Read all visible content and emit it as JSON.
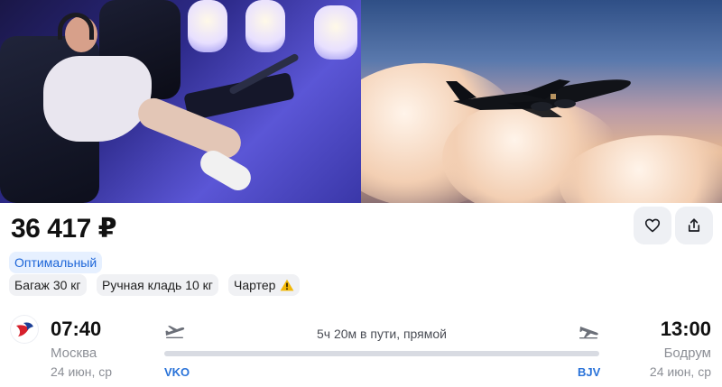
{
  "photos": [
    {
      "name": "cabin-photo",
      "alt_icon": "seat-photo"
    },
    {
      "name": "plane-photo",
      "alt_icon": "plane-in-sky-photo"
    }
  ],
  "offer": {
    "price": "36 417 ₽",
    "actions": {
      "like_icon": "heart-icon",
      "share_icon": "share-icon"
    },
    "tags": {
      "optimal": "Оптимальный",
      "baggage": "Багаж 30 кг",
      "hand_luggage": "Ручная кладь 10 кг",
      "charter": "Чартер"
    }
  },
  "flight": {
    "departure": {
      "time": "07:40",
      "city": "Москва",
      "date": "24 июн, ср",
      "iata": "VKO"
    },
    "arrival": {
      "time": "13:00",
      "city": "Бодрум",
      "date": "24 июн, ср",
      "iata": "BJV"
    },
    "duration": "5ч 20м в пути, прямой"
  },
  "colors": {
    "accent": "#2a73d9",
    "tag_bg": "#e6f0ff",
    "warning": "#f2b705",
    "airline_red": "#d6202c",
    "airline_blue": "#1c3f95"
  }
}
